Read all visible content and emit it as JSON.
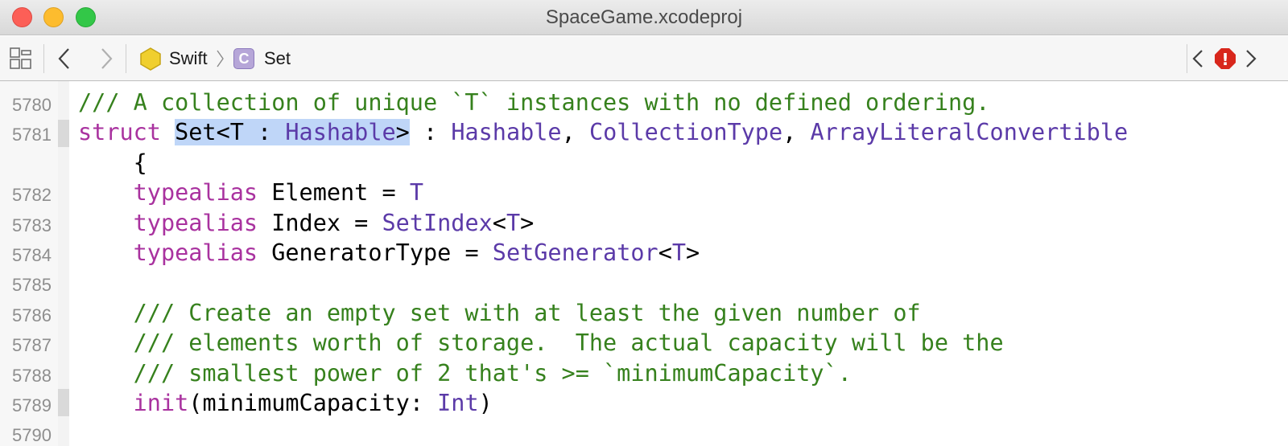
{
  "window": {
    "title": "SpaceGame.xcodeproj",
    "buttons": [
      "close",
      "minimize",
      "zoom"
    ]
  },
  "jumpbar": {
    "grid_icon": "related-items-grid-icon",
    "back_icon": "chevron-left-icon",
    "forward_icon": "chevron-right-icon",
    "breadcrumbs": [
      {
        "label": "Swift",
        "icon": "swift-module-icon"
      },
      {
        "label": "Set",
        "icon": "class-c-icon",
        "badge": "C"
      }
    ],
    "prev_issue_icon": "chevron-left-icon",
    "issue_icon": "error-octagon-icon",
    "issue_badge": "!",
    "next_issue_icon": "chevron-right-icon"
  },
  "colors": {
    "keyword": "#a9329f",
    "type": "#5b3aa8",
    "comment": "#36811d",
    "selection": "#bfd6f8",
    "error": "#d8271c"
  },
  "editor": {
    "lines": [
      {
        "num": "5780",
        "segments": [
          {
            "t": "/// A collection of unique `T` instances with no defined ordering.",
            "c": "cm"
          }
        ]
      },
      {
        "num": "5781",
        "segments": [
          {
            "t": "struct ",
            "c": "kw"
          },
          {
            "t": "Set<T : ",
            "c": "sel"
          },
          {
            "t": "Hashable",
            "c": "sel ty"
          },
          {
            "t": ">",
            "c": "sel"
          },
          {
            "t": " : ",
            "c": ""
          },
          {
            "t": "Hashable",
            "c": "ty"
          },
          {
            "t": ", ",
            "c": ""
          },
          {
            "t": "CollectionType",
            "c": "ty"
          },
          {
            "t": ", ",
            "c": ""
          },
          {
            "t": "ArrayLiteralConvertible",
            "c": "ty"
          }
        ]
      },
      {
        "num": "",
        "segments": [
          {
            "t": "    {",
            "c": ""
          }
        ]
      },
      {
        "num": "5782",
        "segments": [
          {
            "t": "    ",
            "c": ""
          },
          {
            "t": "typealias",
            "c": "kw"
          },
          {
            "t": " Element = ",
            "c": ""
          },
          {
            "t": "T",
            "c": "ty"
          }
        ]
      },
      {
        "num": "5783",
        "segments": [
          {
            "t": "    ",
            "c": ""
          },
          {
            "t": "typealias",
            "c": "kw"
          },
          {
            "t": " Index = ",
            "c": ""
          },
          {
            "t": "SetIndex",
            "c": "ty"
          },
          {
            "t": "<",
            "c": ""
          },
          {
            "t": "T",
            "c": "ty"
          },
          {
            "t": ">",
            "c": ""
          }
        ]
      },
      {
        "num": "5784",
        "segments": [
          {
            "t": "    ",
            "c": ""
          },
          {
            "t": "typealias",
            "c": "kw"
          },
          {
            "t": " GeneratorType = ",
            "c": ""
          },
          {
            "t": "SetGenerator",
            "c": "ty"
          },
          {
            "t": "<",
            "c": ""
          },
          {
            "t": "T",
            "c": "ty"
          },
          {
            "t": ">",
            "c": ""
          }
        ]
      },
      {
        "num": "5785",
        "segments": []
      },
      {
        "num": "5786",
        "segments": [
          {
            "t": "    /// Create an empty set with at least the given number of",
            "c": "cm"
          }
        ]
      },
      {
        "num": "5787",
        "segments": [
          {
            "t": "    /// elements worth of storage.  The actual capacity will be the",
            "c": "cm"
          }
        ]
      },
      {
        "num": "5788",
        "segments": [
          {
            "t": "    /// smallest power of 2 that's >= `minimumCapacity`.",
            "c": "cm"
          }
        ]
      },
      {
        "num": "5789",
        "segments": [
          {
            "t": "    ",
            "c": ""
          },
          {
            "t": "init",
            "c": "kw"
          },
          {
            "t": "(minimumCapacity: ",
            "c": ""
          },
          {
            "t": "Int",
            "c": "ty"
          },
          {
            "t": ")",
            "c": ""
          }
        ]
      },
      {
        "num": "5790",
        "segments": []
      }
    ]
  }
}
